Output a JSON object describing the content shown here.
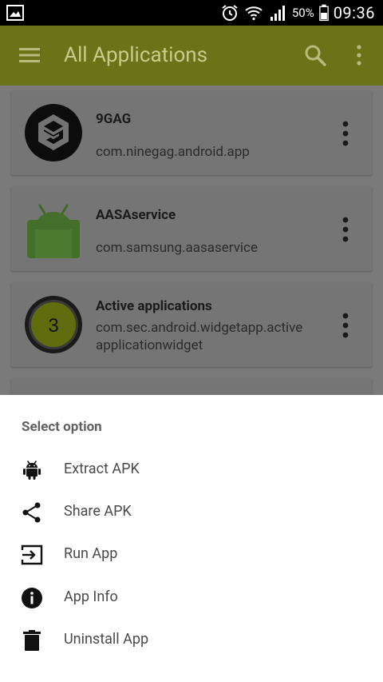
{
  "status_bar": {
    "battery_percent": "50%",
    "time": "09:36"
  },
  "app_bar": {
    "title": "All Applications"
  },
  "apps": [
    {
      "name": "9GAG",
      "package": "com.ninegag.android.app",
      "icon": "ninegag-logo-icon"
    },
    {
      "name": "AASAservice",
      "package": "com.samsung.aasaservice",
      "icon": "android-robot-icon"
    },
    {
      "name": "Active applications",
      "package": "com.sec.android.widgetapp.activeapplicationwidget",
      "package_line1": "com.sec.android.widgetapp.active",
      "package_line2": "applicationwidget",
      "icon": "active-apps-counter-icon",
      "badge": "3"
    }
  ],
  "sheet": {
    "title": "Select option",
    "options": [
      {
        "label": "Extract APK",
        "icon": "android-icon"
      },
      {
        "label": "Share APK",
        "icon": "share-icon"
      },
      {
        "label": "Run App",
        "icon": "run-app-icon"
      },
      {
        "label": "App Info",
        "icon": "info-icon"
      },
      {
        "label": "Uninstall App",
        "icon": "trash-icon"
      }
    ]
  },
  "colors": {
    "app_bar": "#6a7317",
    "scrim": "#7a7a7a",
    "sheet_bg": "#ffffff"
  }
}
